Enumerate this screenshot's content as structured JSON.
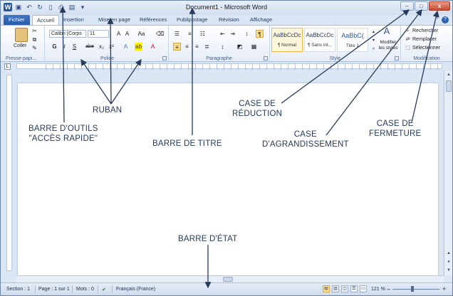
{
  "title": "Document1 - Microsoft Word",
  "window_buttons": {
    "minimize": "–",
    "maximize": "□",
    "close": "x"
  },
  "tabs": [
    {
      "label": "Fichier"
    },
    {
      "label": "Accueil"
    },
    {
      "label": "Insertion"
    },
    {
      "label": "Mise en page"
    },
    {
      "label": "Références"
    },
    {
      "label": "Publipostage"
    },
    {
      "label": "Révision"
    },
    {
      "label": "Affichage"
    }
  ],
  "ribbon": {
    "clipboard": {
      "paste": "Coller",
      "label": "Presse-papi..."
    },
    "font": {
      "name": "Calibri (Corps",
      "size": "11",
      "label": "Police",
      "bold": "G",
      "italic": "I",
      "underline": "S",
      "strike": "abe",
      "sub": "x₂",
      "sup": "x²"
    },
    "paragraph": {
      "label": "Paragraphe"
    },
    "styles": {
      "label": "Style",
      "items": [
        {
          "sample": "AaBbCcDc",
          "name": "¶ Normal"
        },
        {
          "sample": "AaBbCcDc",
          "name": "¶ Sans int..."
        },
        {
          "sample": "AaBbC(",
          "name": "Titre 1"
        }
      ],
      "change_styles": "Modifier les styles"
    },
    "editing": {
      "find": "Rechercher",
      "replace": "Remplacer",
      "select": "Sélectionner",
      "label": "Modification"
    }
  },
  "status": {
    "section": "Section : 1",
    "page": "Page : 1 sur 1",
    "words": "Mots : 0",
    "language": "Français (France)",
    "zoom": "121 %",
    "zoom_out": "–",
    "zoom_in": "+"
  },
  "annotations": {
    "ruban": "RUBAN",
    "qat_line1": "BARRE D'OUTILS",
    "qat_line2": "\"ACCÈS RAPIDE\"",
    "titre": "BARRE DE TITRE",
    "reduction_line1": "CASE DE",
    "reduction_line2": "RÉDUCTION",
    "agrandissement_line1": "CASE",
    "agrandissement_line2": "D'AGRANDISSEMENT",
    "fermeture_line1": "CASE DE",
    "fermeture_line2": "FERMETURE",
    "etat": "BARRE D'ÉTAT"
  }
}
